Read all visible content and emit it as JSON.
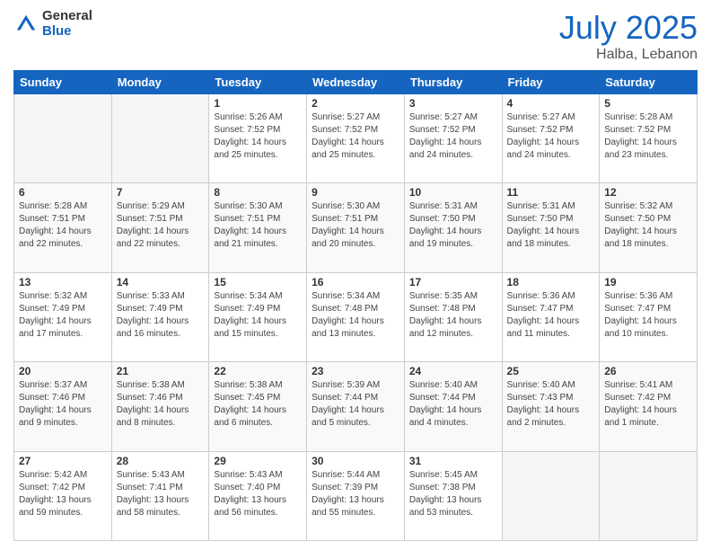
{
  "logo": {
    "general": "General",
    "blue": "Blue"
  },
  "header": {
    "month": "July 2025",
    "location": "Halba, Lebanon"
  },
  "weekdays": [
    "Sunday",
    "Monday",
    "Tuesday",
    "Wednesday",
    "Thursday",
    "Friday",
    "Saturday"
  ],
  "weeks": [
    [
      {
        "day": "",
        "empty": true
      },
      {
        "day": "",
        "empty": true
      },
      {
        "day": "1",
        "sunrise": "Sunrise: 5:26 AM",
        "sunset": "Sunset: 7:52 PM",
        "daylight": "Daylight: 14 hours and 25 minutes."
      },
      {
        "day": "2",
        "sunrise": "Sunrise: 5:27 AM",
        "sunset": "Sunset: 7:52 PM",
        "daylight": "Daylight: 14 hours and 25 minutes."
      },
      {
        "day": "3",
        "sunrise": "Sunrise: 5:27 AM",
        "sunset": "Sunset: 7:52 PM",
        "daylight": "Daylight: 14 hours and 24 minutes."
      },
      {
        "day": "4",
        "sunrise": "Sunrise: 5:27 AM",
        "sunset": "Sunset: 7:52 PM",
        "daylight": "Daylight: 14 hours and 24 minutes."
      },
      {
        "day": "5",
        "sunrise": "Sunrise: 5:28 AM",
        "sunset": "Sunset: 7:52 PM",
        "daylight": "Daylight: 14 hours and 23 minutes."
      }
    ],
    [
      {
        "day": "6",
        "sunrise": "Sunrise: 5:28 AM",
        "sunset": "Sunset: 7:51 PM",
        "daylight": "Daylight: 14 hours and 22 minutes."
      },
      {
        "day": "7",
        "sunrise": "Sunrise: 5:29 AM",
        "sunset": "Sunset: 7:51 PM",
        "daylight": "Daylight: 14 hours and 22 minutes."
      },
      {
        "day": "8",
        "sunrise": "Sunrise: 5:30 AM",
        "sunset": "Sunset: 7:51 PM",
        "daylight": "Daylight: 14 hours and 21 minutes."
      },
      {
        "day": "9",
        "sunrise": "Sunrise: 5:30 AM",
        "sunset": "Sunset: 7:51 PM",
        "daylight": "Daylight: 14 hours and 20 minutes."
      },
      {
        "day": "10",
        "sunrise": "Sunrise: 5:31 AM",
        "sunset": "Sunset: 7:50 PM",
        "daylight": "Daylight: 14 hours and 19 minutes."
      },
      {
        "day": "11",
        "sunrise": "Sunrise: 5:31 AM",
        "sunset": "Sunset: 7:50 PM",
        "daylight": "Daylight: 14 hours and 18 minutes."
      },
      {
        "day": "12",
        "sunrise": "Sunrise: 5:32 AM",
        "sunset": "Sunset: 7:50 PM",
        "daylight": "Daylight: 14 hours and 18 minutes."
      }
    ],
    [
      {
        "day": "13",
        "sunrise": "Sunrise: 5:32 AM",
        "sunset": "Sunset: 7:49 PM",
        "daylight": "Daylight: 14 hours and 17 minutes."
      },
      {
        "day": "14",
        "sunrise": "Sunrise: 5:33 AM",
        "sunset": "Sunset: 7:49 PM",
        "daylight": "Daylight: 14 hours and 16 minutes."
      },
      {
        "day": "15",
        "sunrise": "Sunrise: 5:34 AM",
        "sunset": "Sunset: 7:49 PM",
        "daylight": "Daylight: 14 hours and 15 minutes."
      },
      {
        "day": "16",
        "sunrise": "Sunrise: 5:34 AM",
        "sunset": "Sunset: 7:48 PM",
        "daylight": "Daylight: 14 hours and 13 minutes."
      },
      {
        "day": "17",
        "sunrise": "Sunrise: 5:35 AM",
        "sunset": "Sunset: 7:48 PM",
        "daylight": "Daylight: 14 hours and 12 minutes."
      },
      {
        "day": "18",
        "sunrise": "Sunrise: 5:36 AM",
        "sunset": "Sunset: 7:47 PM",
        "daylight": "Daylight: 14 hours and 11 minutes."
      },
      {
        "day": "19",
        "sunrise": "Sunrise: 5:36 AM",
        "sunset": "Sunset: 7:47 PM",
        "daylight": "Daylight: 14 hours and 10 minutes."
      }
    ],
    [
      {
        "day": "20",
        "sunrise": "Sunrise: 5:37 AM",
        "sunset": "Sunset: 7:46 PM",
        "daylight": "Daylight: 14 hours and 9 minutes."
      },
      {
        "day": "21",
        "sunrise": "Sunrise: 5:38 AM",
        "sunset": "Sunset: 7:46 PM",
        "daylight": "Daylight: 14 hours and 8 minutes."
      },
      {
        "day": "22",
        "sunrise": "Sunrise: 5:38 AM",
        "sunset": "Sunset: 7:45 PM",
        "daylight": "Daylight: 14 hours and 6 minutes."
      },
      {
        "day": "23",
        "sunrise": "Sunrise: 5:39 AM",
        "sunset": "Sunset: 7:44 PM",
        "daylight": "Daylight: 14 hours and 5 minutes."
      },
      {
        "day": "24",
        "sunrise": "Sunrise: 5:40 AM",
        "sunset": "Sunset: 7:44 PM",
        "daylight": "Daylight: 14 hours and 4 minutes."
      },
      {
        "day": "25",
        "sunrise": "Sunrise: 5:40 AM",
        "sunset": "Sunset: 7:43 PM",
        "daylight": "Daylight: 14 hours and 2 minutes."
      },
      {
        "day": "26",
        "sunrise": "Sunrise: 5:41 AM",
        "sunset": "Sunset: 7:42 PM",
        "daylight": "Daylight: 14 hours and 1 minute."
      }
    ],
    [
      {
        "day": "27",
        "sunrise": "Sunrise: 5:42 AM",
        "sunset": "Sunset: 7:42 PM",
        "daylight": "Daylight: 13 hours and 59 minutes."
      },
      {
        "day": "28",
        "sunrise": "Sunrise: 5:43 AM",
        "sunset": "Sunset: 7:41 PM",
        "daylight": "Daylight: 13 hours and 58 minutes."
      },
      {
        "day": "29",
        "sunrise": "Sunrise: 5:43 AM",
        "sunset": "Sunset: 7:40 PM",
        "daylight": "Daylight: 13 hours and 56 minutes."
      },
      {
        "day": "30",
        "sunrise": "Sunrise: 5:44 AM",
        "sunset": "Sunset: 7:39 PM",
        "daylight": "Daylight: 13 hours and 55 minutes."
      },
      {
        "day": "31",
        "sunrise": "Sunrise: 5:45 AM",
        "sunset": "Sunset: 7:38 PM",
        "daylight": "Daylight: 13 hours and 53 minutes."
      },
      {
        "day": "",
        "empty": true
      },
      {
        "day": "",
        "empty": true
      }
    ]
  ]
}
